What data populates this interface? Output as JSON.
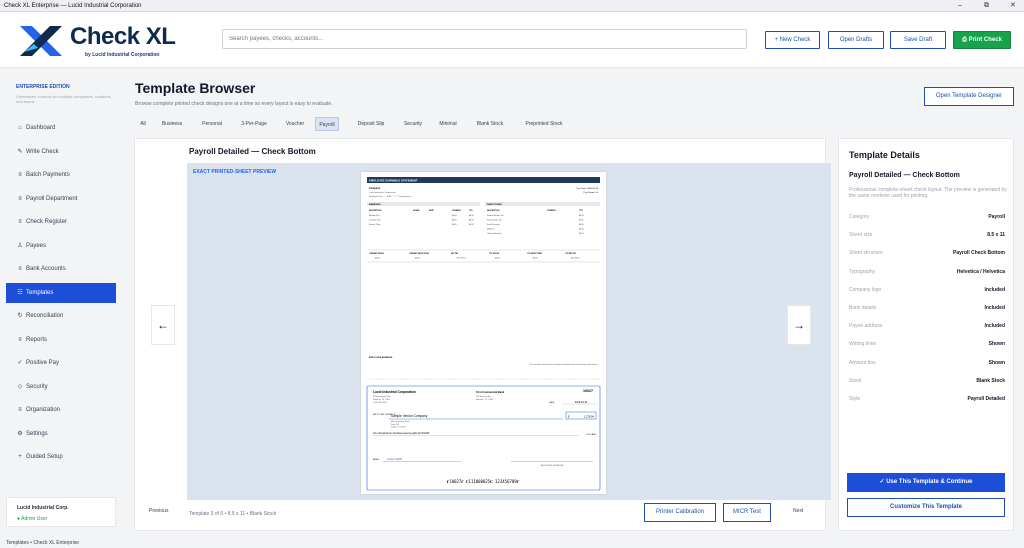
{
  "window": {
    "title": "Check XL Enterprise — Lucid Industrial Corporation",
    "min": "–",
    "max": "⧉",
    "close": "✕"
  },
  "header": {
    "brand": "Check XL",
    "brand_sub": "by Lucid Industrial Corporation",
    "search_placeholder": "Search payees, checks, accounts...",
    "buttons": {
      "new_check": "+ New Check",
      "open_drafts": "Open Drafts",
      "save_draft": "Save Draft",
      "print_check": "Print Check"
    }
  },
  "sidebar": {
    "edition": "ENTERPRISE EDITION",
    "edition_desc": "Centralized controls for multiple companies, locations, and teams",
    "items": [
      {
        "icon": "⌂",
        "label": "Dashboard"
      },
      {
        "icon": "✎",
        "label": "Write Check"
      },
      {
        "icon": "≡",
        "label": "Batch Payments"
      },
      {
        "icon": "≡",
        "label": "Payroll Department"
      },
      {
        "icon": "≡",
        "label": "Check Register"
      },
      {
        "icon": "♙",
        "label": "Payees"
      },
      {
        "icon": "≡",
        "label": "Bank Accounts"
      },
      {
        "icon": "☷",
        "label": "Templates"
      },
      {
        "icon": "↻",
        "label": "Reconciliation"
      },
      {
        "icon": "≡",
        "label": "Reports"
      },
      {
        "icon": "✓",
        "label": "Positive Pay"
      },
      {
        "icon": "◇",
        "label": "Security"
      },
      {
        "icon": "≡",
        "label": "Organization"
      },
      {
        "icon": "⚙",
        "label": "Settings"
      },
      {
        "icon": "+",
        "label": "Guided Setup"
      }
    ],
    "user": {
      "company": "Lucid Industrial Corp.",
      "role": "Admin User"
    }
  },
  "main": {
    "title": "Template Browser",
    "desc": "Browse complete printed check designs one at a time so every layout is easy to evaluate.",
    "open_designer": "Open Template Designer",
    "tabs": [
      "All",
      "Business",
      "Personal",
      "3-Per-Page",
      "Voucher",
      "Payroll",
      "Deposit Slip",
      "Security",
      "Minimal",
      "Blank Stock",
      "Preprinted Stock"
    ]
  },
  "viewer": {
    "title": "Payroll Detailed — Check Bottom",
    "label": "EXACT PRINTED-SHEET PREVIEW",
    "prev_arrow": "←",
    "next_arrow": "→",
    "previous": "Previous",
    "next": "Next",
    "pager_info": "Template 3 of 6  •  8.5 x 11  •  Blank Stock",
    "printer_calibration": "Printer Calibration",
    "micr_test": "MICR Test"
  },
  "preview": {
    "stub_header": "EMPLOYEE EARNINGS STATEMENT",
    "company_label": "Company:",
    "company_value": "Lucid Industrial Corporation",
    "pay_date": "Pay Date: 2026-03-10",
    "pay_period": "Pay Period: 14",
    "employee": "Employee No.: —  SSN: ***-**-  Department: —",
    "earnings_title": "EARNINGS",
    "deductions_title": "DEDUCTIONS",
    "earn_cols": [
      "DESCRIPTION",
      "HOURS",
      "RATE",
      "CURRENT",
      "YTD"
    ],
    "earn_rows": [
      [
        "Regular Pay",
        "",
        "",
        "$0.00",
        "$0.00"
      ],
      [
        "Overtime Pay",
        "",
        "",
        "$0.00",
        "$0.00"
      ],
      [
        "Bonus / Other",
        "",
        "",
        "$0.00",
        "$0.00"
      ]
    ],
    "ded_cols": [
      "DESCRIPTION",
      "CURRENT",
      "YTD"
    ],
    "ded_rows": [
      [
        "Federal Income Tax",
        "",
        "$0.00"
      ],
      [
        "State Income Tax",
        "",
        "$0.00"
      ],
      [
        "Social Security",
        "",
        "$0.00"
      ],
      [
        "Medicare",
        "",
        "$0.00"
      ],
      [
        "Other Deductions",
        "",
        "$0.00"
      ]
    ],
    "totals_cols": [
      "CURRENT GROSS",
      "CURRENT DEDUCTIONS",
      "NET PAY",
      "YTD GROSS",
      "YTD DEDUCTIONS",
      "YTD NET PAY"
    ],
    "totals_vals": [
      "$0.00",
      "$0.00",
      "$1,278.54",
      "$0.00",
      "$0.00",
      "$1,278.54"
    ],
    "emp_address": "EMPLOYEE ADDRESS",
    "stub_note": "This statement documents earnings and deductions for the pay period shown.",
    "chk_company": "Lucid Industrial Corporation",
    "chk_addr": [
      "1234 Industrial Way",
      "Houston, TX 77001",
      "(713) 555-0100"
    ],
    "bank": "First Commercial Bank",
    "bank_addr": [
      "100 Finance Ave",
      "Houston, TX 77002"
    ],
    "check_no": "10027",
    "date_label": "DATE",
    "date_value": "2026-03-10",
    "pay_to": "PAY TO THE ORDER OF",
    "payee": "Sample Vendor Company",
    "payee_addr": [
      "456 Commerce Street",
      "Suite 200",
      "Dallas, TX 75201"
    ],
    "amount": "1,278.54",
    "amount_words": "One thousand two hundred seventy-eight and 54/100",
    "dollars": "DOLLARS",
    "memo_label": "MEMO",
    "memo_value": "Invoice 10482",
    "signature": "AUTHORIZED SIGNATURE",
    "micr": "⑈10027⑈ ⑆111000025⑆ 123456789⑈"
  },
  "details": {
    "heading": "Template Details",
    "name": "Payroll Detailed — Check Bottom",
    "desc": "Professional complete-sheet check layout. The preview is generated by the same renderer used for printing.",
    "rows": [
      {
        "k": "Category",
        "v": "Payroll"
      },
      {
        "k": "Sheet size",
        "v": "8.5 x 11"
      },
      {
        "k": "Sheet structure",
        "v": "Payroll Check Bottom"
      },
      {
        "k": "Typography",
        "v": "Helvetica / Helvetica"
      },
      {
        "k": "Company logo",
        "v": "Included"
      },
      {
        "k": "Bank details",
        "v": "Included"
      },
      {
        "k": "Payee address",
        "v": "Included"
      },
      {
        "k": "Writing lines",
        "v": "Shown"
      },
      {
        "k": "Amount box",
        "v": "Shown"
      },
      {
        "k": "Stock",
        "v": "Blank Stock"
      },
      {
        "k": "Style",
        "v": "Payroll Detailed"
      }
    ],
    "use_button": "✓  Use This Template & Continue",
    "customize_button": "Customize This Template"
  },
  "status": "Templates • Check XL Enterprise",
  "colors": {
    "accent": "#1d4ed8",
    "green": "#16a34a",
    "navy": "#0f2a4a"
  }
}
